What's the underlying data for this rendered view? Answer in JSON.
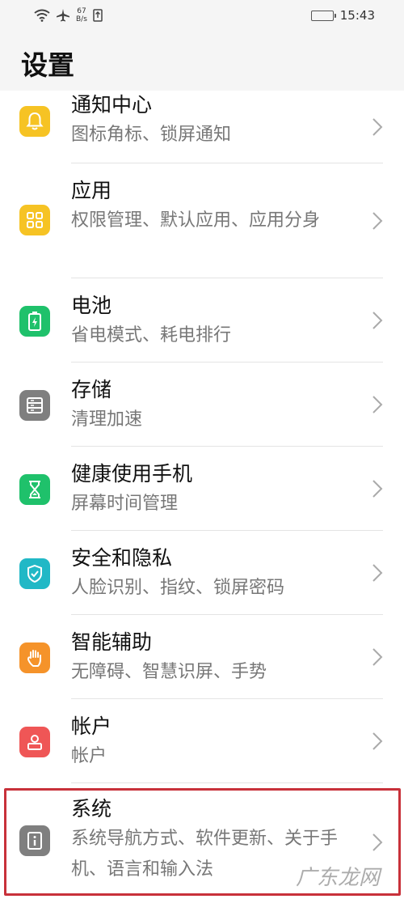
{
  "status": {
    "net_speed_value": "67",
    "net_speed_unit": "B/s",
    "time": "15:43"
  },
  "page": {
    "title": "设置"
  },
  "settings": [
    {
      "title": "通知中心",
      "sub": "图标角标、锁屏通知",
      "icon": "bell-icon",
      "color": "#f6c324"
    },
    {
      "title": "应用",
      "sub": "权限管理、默认应用、应用分身",
      "icon": "apps-grid-icon",
      "color": "#f6c324"
    },
    {
      "title": "电池",
      "sub": "省电模式、耗电排行",
      "icon": "battery-icon",
      "color": "#1fc16b"
    },
    {
      "title": "存储",
      "sub": "清理加速",
      "icon": "storage-icon",
      "color": "#7f7f7f"
    },
    {
      "title": "健康使用手机",
      "sub": "屏幕时间管理",
      "icon": "hourglass-icon",
      "color": "#1fc16b"
    },
    {
      "title": "安全和隐私",
      "sub": "人脸识别、指纹、锁屏密码",
      "icon": "shield-check-icon",
      "color": "#21b8c6"
    },
    {
      "title": "智能辅助",
      "sub": "无障碍、智慧识屏、手势",
      "icon": "hand-icon",
      "color": "#f5932a"
    },
    {
      "title": "帐户",
      "sub": "帐户",
      "icon": "person-icon",
      "color": "#ef5656"
    },
    {
      "title": "系统",
      "sub": "系统导航方式、软件更新、关于手机、语言和输入法",
      "icon": "info-icon",
      "color": "#7f7f7f"
    }
  ],
  "watermark": "广东龙网"
}
